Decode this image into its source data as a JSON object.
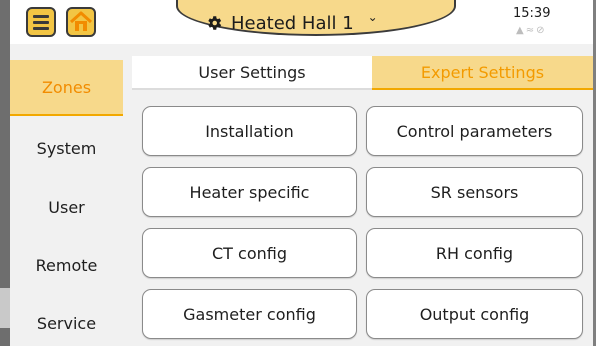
{
  "header": {
    "zone_title": "Heated Hall 1",
    "time": "15:39"
  },
  "sidebar": {
    "items": [
      {
        "label": "Zones",
        "active": true
      },
      {
        "label": "System"
      },
      {
        "label": "User"
      },
      {
        "label": "Remote"
      },
      {
        "label": "Service"
      }
    ]
  },
  "tabs": {
    "user_label": "User Settings",
    "expert_label": "Expert Settings"
  },
  "buttons": [
    {
      "label": "Installation"
    },
    {
      "label": "Control parameters"
    },
    {
      "label": "Heater specific"
    },
    {
      "label": "SR sensors"
    },
    {
      "label": "CT config"
    },
    {
      "label": "RH config"
    },
    {
      "label": "Gasmeter config"
    },
    {
      "label": "Output config"
    }
  ],
  "colors": {
    "accent_yellow": "#f7d98b",
    "accent_orange": "#f39b00",
    "frame_gray": "#7f7f7f"
  }
}
